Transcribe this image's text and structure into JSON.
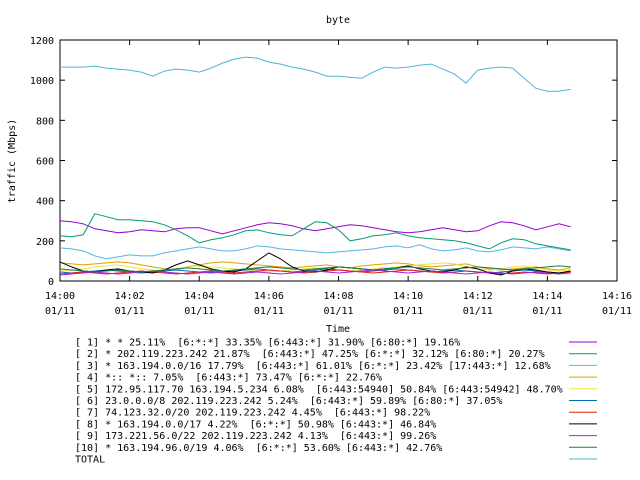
{
  "chart_data": {
    "type": "line",
    "title": "byte",
    "xlabel": "Time",
    "ylabel": "traffic (Mbps)",
    "ylim": [
      0,
      1200
    ],
    "xlim": [
      "14:00",
      "14:16"
    ],
    "grid": false,
    "legend_position": "bottom",
    "y_ticks": [
      "0",
      "200",
      "400",
      "600",
      "800",
      "1000",
      "1200"
    ],
    "x_ticks": [
      {
        "time": "14:00",
        "date": "01/11"
      },
      {
        "time": "14:02",
        "date": "01/11"
      },
      {
        "time": "14:04",
        "date": "01/11"
      },
      {
        "time": "14:06",
        "date": "01/11"
      },
      {
        "time": "14:08",
        "date": "01/11"
      },
      {
        "time": "14:10",
        "date": "01/11"
      },
      {
        "time": "14:12",
        "date": "01/11"
      },
      {
        "time": "14:14",
        "date": "01/11"
      },
      {
        "time": "14:16",
        "date": "01/11"
      }
    ],
    "x": [
      "14:00:00",
      "14:00:20",
      "14:00:40",
      "14:01:00",
      "14:01:20",
      "14:01:40",
      "14:02:00",
      "14:02:20",
      "14:02:40",
      "14:03:00",
      "14:03:20",
      "14:03:40",
      "14:04:00",
      "14:04:20",
      "14:04:40",
      "14:05:00",
      "14:05:20",
      "14:05:40",
      "14:06:00",
      "14:06:20",
      "14:06:40",
      "14:07:00",
      "14:07:20",
      "14:07:40",
      "14:08:00",
      "14:08:20",
      "14:08:40",
      "14:09:00",
      "14:09:20",
      "14:09:40",
      "14:10:00",
      "14:10:20",
      "14:10:40",
      "14:11:00",
      "14:11:20",
      "14:11:40",
      "14:12:00",
      "14:12:20",
      "14:12:40",
      "14:13:00",
      "14:13:20",
      "14:13:40",
      "14:14:00",
      "14:14:20",
      "14:14:40"
    ],
    "series": [
      {
        "name": "[ 1] * * 25.11%  [6:*:*] 33.35% [6:443:*] 31.90% [6:80:*] 19.16%",
        "color": "#9400d3",
        "values": [
          300,
          295,
          285,
          260,
          250,
          240,
          245,
          255,
          250,
          245,
          260,
          265,
          265,
          250,
          235,
          250,
          265,
          280,
          290,
          285,
          275,
          260,
          250,
          260,
          270,
          280,
          275,
          265,
          255,
          245,
          240,
          245,
          255,
          265,
          255,
          245,
          250,
          275,
          295,
          290,
          275,
          255,
          270,
          285,
          270
        ]
      },
      {
        "name": "[ 2] * 202.119.223.242 21.87%  [6:443:*] 47.25% [6:*:*] 32.12% [6:80:*] 20.27%",
        "color": "#009e73",
        "values": [
          225,
          220,
          230,
          335,
          320,
          305,
          305,
          300,
          295,
          280,
          255,
          225,
          190,
          205,
          215,
          230,
          250,
          255,
          240,
          230,
          225,
          260,
          295,
          290,
          255,
          200,
          210,
          225,
          230,
          240,
          225,
          215,
          210,
          205,
          200,
          190,
          175,
          160,
          190,
          210,
          205,
          185,
          175,
          165,
          155
        ]
      },
      {
        "name": "[ 3] * 163.194.0.0/16 17.79%  [6:443:*] 61.01% [6:*:*] 23.42% [17:443:*] 12.68%",
        "color": "#56b4e9",
        "values": [
          165,
          160,
          150,
          125,
          110,
          120,
          130,
          125,
          125,
          140,
          150,
          160,
          170,
          160,
          150,
          150,
          160,
          175,
          170,
          160,
          155,
          150,
          145,
          140,
          145,
          150,
          155,
          160,
          170,
          175,
          165,
          180,
          160,
          150,
          155,
          165,
          150,
          145,
          155,
          170,
          165,
          160,
          170,
          160,
          150
        ]
      },
      {
        "name": "[ 4] *:: *:: 7.05%  [6:443:*] 73.47% [6:*:*] 22.76%",
        "color": "#e69f00",
        "values": [
          90,
          85,
          80,
          85,
          90,
          95,
          90,
          80,
          70,
          60,
          55,
          70,
          80,
          90,
          95,
          90,
          85,
          80,
          75,
          70,
          65,
          70,
          75,
          80,
          70,
          65,
          75,
          80,
          85,
          90,
          85,
          75,
          70,
          75,
          80,
          85,
          70,
          60,
          55,
          60,
          65,
          70,
          60,
          55,
          65
        ]
      },
      {
        "name": "[ 5] 172.95.117.70 163.194.5.234 6.08%  [6:443:54940] 50.84% [6:443:54942] 48.70%",
        "color": "#f0e442",
        "values": [
          50,
          55,
          60,
          70,
          75,
          80,
          70,
          60,
          55,
          50,
          60,
          70,
          75,
          70,
          65,
          60,
          55,
          50,
          45,
          50,
          55,
          60,
          65,
          60,
          55,
          50,
          55,
          60,
          65,
          70,
          75,
          80,
          85,
          90,
          85,
          70,
          60,
          55,
          60,
          70,
          75,
          65,
          55,
          50,
          55
        ]
      },
      {
        "name": "[ 6] 23.0.0.0/8 202.119.223.242 5.24%  [6:443:*] 59.89% [6:80:*] 37.05%",
        "color": "#0072b2",
        "values": [
          45,
          40,
          45,
          50,
          55,
          50,
          45,
          40,
          45,
          50,
          55,
          50,
          45,
          40,
          45,
          50,
          55,
          60,
          55,
          50,
          45,
          50,
          55,
          60,
          55,
          50,
          45,
          50,
          55,
          60,
          55,
          50,
          45,
          50,
          55,
          50,
          45,
          40,
          45,
          50,
          55,
          50,
          45,
          40,
          45
        ]
      },
      {
        "name": "[ 7] 74.123.32.0/20 202.119.223.242 4.45%  [6:443:*] 98.22%",
        "color": "#e51e10",
        "values": [
          35,
          40,
          45,
          40,
          35,
          40,
          45,
          50,
          45,
          40,
          35,
          40,
          45,
          50,
          45,
          40,
          45,
          50,
          55,
          50,
          45,
          40,
          45,
          50,
          55,
          50,
          45,
          40,
          45,
          50,
          55,
          50,
          45,
          40,
          45,
          50,
          45,
          40,
          35,
          40,
          45,
          40,
          35,
          40,
          45
        ]
      },
      {
        "name": "[ 8] * 163.194.0.0/17 4.22%  [6:*:*] 50.98% [6:443:*] 46.84%",
        "color": "#000000",
        "values": [
          95,
          70,
          50,
          45,
          55,
          60,
          50,
          45,
          40,
          55,
          80,
          100,
          80,
          60,
          50,
          45,
          60,
          100,
          140,
          110,
          70,
          50,
          45,
          55,
          70,
          65,
          60,
          55,
          60,
          65,
          75,
          60,
          50,
          45,
          55,
          70,
          60,
          40,
          30,
          50,
          60,
          55,
          45,
          40,
          50
        ]
      },
      {
        "name": "[ 9] 173.221.56.0/22 202.119.223.242 4.13%  [6:443:*] 99.26%",
        "color": "#a020f0",
        "values": [
          30,
          35,
          40,
          45,
          40,
          35,
          40,
          45,
          50,
          45,
          40,
          35,
          40,
          45,
          40,
          35,
          40,
          45,
          40,
          35,
          40,
          45,
          50,
          45,
          40,
          45,
          50,
          55,
          50,
          45,
          40,
          45,
          50,
          45,
          40,
          35,
          40,
          45,
          40,
          35,
          40,
          45,
          40,
          35,
          40
        ]
      },
      {
        "name": "[10] * 163.194.96.0/19 4.06%  [6:*:*] 53.60% [6:443:*] 42.76%",
        "color": "#1a7a4a",
        "values": [
          60,
          55,
          50,
          45,
          50,
          55,
          50,
          45,
          50,
          55,
          60,
          65,
          60,
          55,
          50,
          55,
          60,
          65,
          70,
          65,
          60,
          55,
          60,
          65,
          70,
          65,
          60,
          55,
          60,
          65,
          70,
          65,
          60,
          55,
          60,
          65,
          70,
          65,
          60,
          55,
          60,
          65,
          70,
          75,
          70
        ]
      },
      {
        "name": "TOTAL",
        "color": "#4fb3d9",
        "values": [
          1065,
          1065,
          1065,
          1070,
          1060,
          1055,
          1050,
          1040,
          1020,
          1045,
          1055,
          1050,
          1040,
          1060,
          1085,
          1105,
          1115,
          1110,
          1090,
          1080,
          1065,
          1055,
          1040,
          1020,
          1020,
          1015,
          1010,
          1040,
          1065,
          1060,
          1065,
          1075,
          1080,
          1055,
          1030,
          985,
          1050,
          1060,
          1065,
          1060,
          1010,
          960,
          945,
          945,
          955
        ]
      }
    ]
  }
}
